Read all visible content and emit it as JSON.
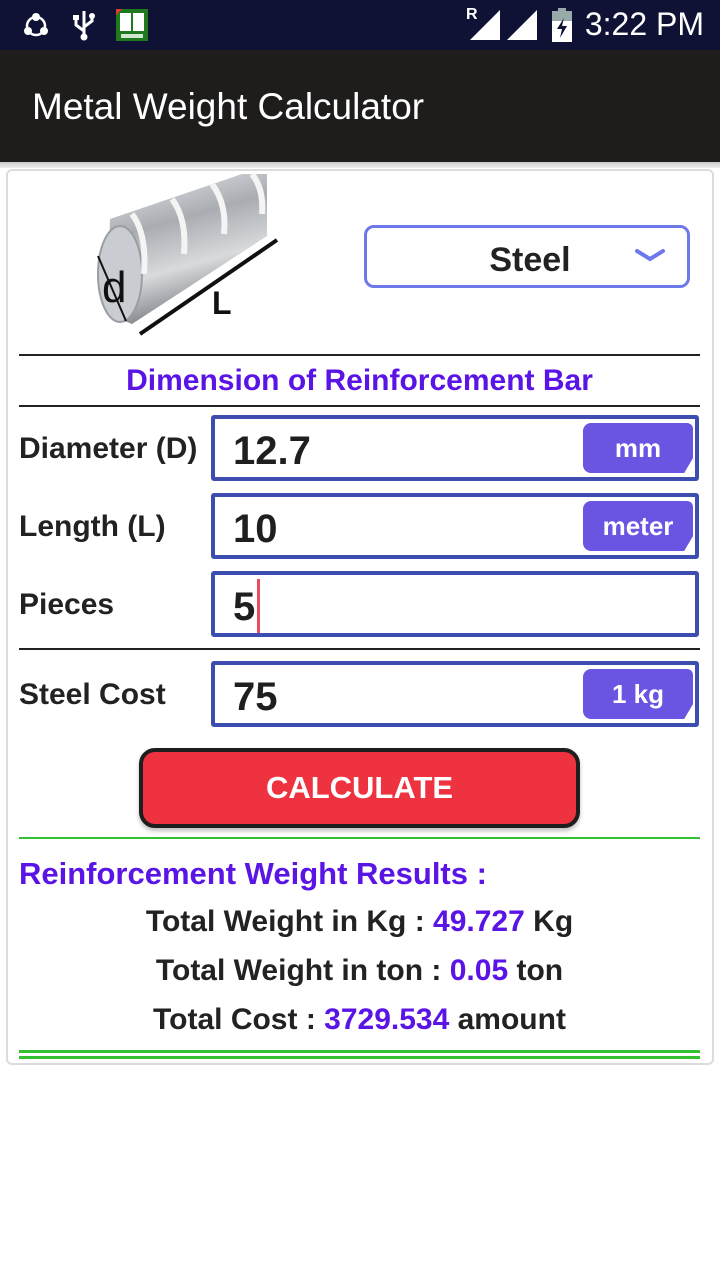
{
  "status_bar": {
    "time": "3:22 PM",
    "icons": [
      "shareit-icon",
      "usb-icon",
      "dictionary-app-icon",
      "signal-roaming-icon",
      "signal-icon",
      "battery-charging-icon"
    ],
    "roaming_label": "R"
  },
  "app_bar": {
    "title": "Metal Weight Calculator"
  },
  "material_select": {
    "value": "Steel"
  },
  "image": {
    "diameter_label": "d",
    "length_label": "L"
  },
  "section_title": "Dimension of Reinforcement Bar",
  "fields": [
    {
      "label": "Diameter (D)",
      "value": "12.7",
      "unit": "mm"
    },
    {
      "label": "Length (L)",
      "value": "10",
      "unit": "meter"
    },
    {
      "label": "Pieces",
      "value": "5",
      "unit": null
    },
    {
      "label": "Steel Cost",
      "value": "75",
      "unit": "1 kg"
    }
  ],
  "calculate_label": "CALCULATE",
  "results": {
    "title": "Reinforcement Weight Results :",
    "lines": [
      {
        "label": "Total Weight in Kg : ",
        "value": "49.727",
        "unit": " Kg"
      },
      {
        "label": "Total Weight in ton : ",
        "value": "0.05",
        "unit": " ton"
      },
      {
        "label": "Total Cost : ",
        "value": "3729.534",
        "unit": " amount"
      }
    ]
  },
  "colors": {
    "accent_purple": "#5a14e6",
    "field_border": "#3d4eb0",
    "unit_tag": "#6a55e2",
    "button_red": "#ef323f",
    "divider_green": "#33c033",
    "status_bar": "#0f1235",
    "app_bar": "#1e1d1c"
  }
}
